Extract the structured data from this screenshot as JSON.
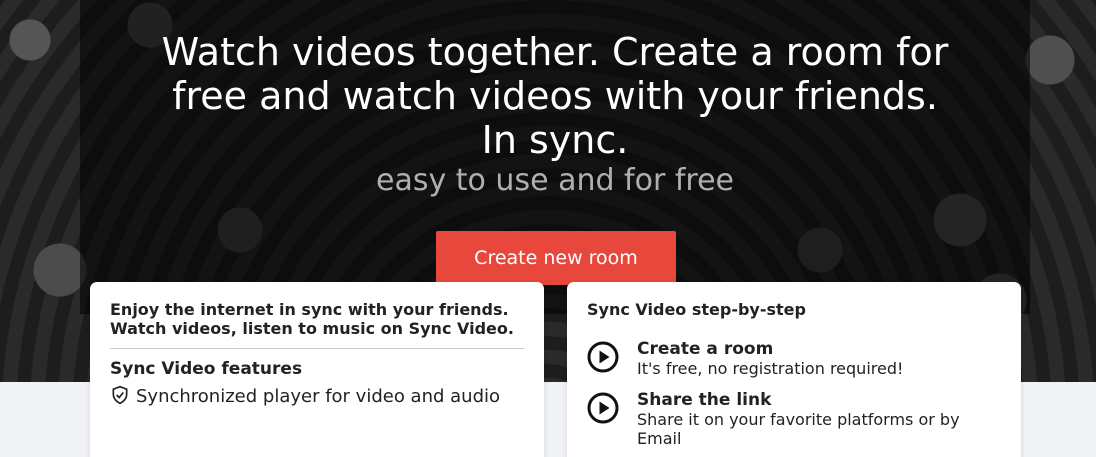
{
  "hero": {
    "title": "Watch videos together. Create a room for free and watch videos with your friends. In sync.",
    "subtitle": "easy to use and for free",
    "cta_label": "Create new room"
  },
  "features_card": {
    "intro": "Enjoy the internet in sync with your friends. Watch videos, listen to music on Sync Video.",
    "section_title": "Sync Video features",
    "items": [
      {
        "icon": "shield-check-icon",
        "label": "Synchronized player for video and audio"
      }
    ]
  },
  "steps_card": {
    "title": "Sync Video step-by-step",
    "steps": [
      {
        "icon": "play-circle-icon",
        "title": "Create a room",
        "desc": "It's free, no registration required!"
      },
      {
        "icon": "play-circle-icon",
        "title": "Share the link",
        "desc": "Share it on your favorite platforms or by Email"
      }
    ]
  },
  "colors": {
    "accent": "#e8473b",
    "page_bg": "#f0f2f5"
  }
}
